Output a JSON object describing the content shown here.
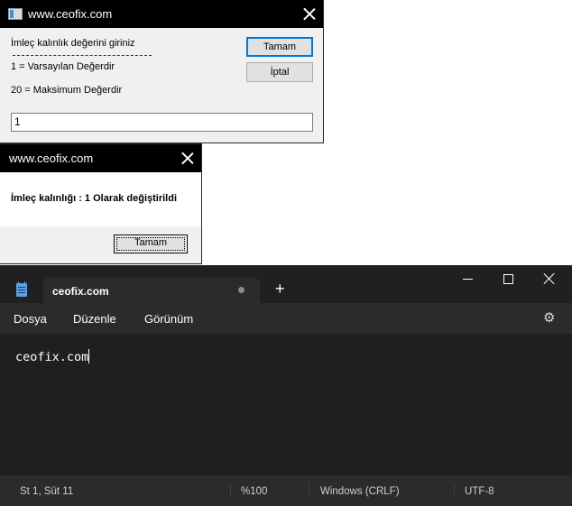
{
  "input_dialog": {
    "title": "www.ceofix.com",
    "prompt_line1": "İmleç kalınlık değerini giriniz",
    "prompt_line2": "1 = Varsayılan Değerdir",
    "prompt_line3": "20 = Maksimum Değerdir",
    "ok_label": "Tamam",
    "cancel_label": "İptal",
    "input_value": "1"
  },
  "message_dialog": {
    "title": "www.ceofix.com",
    "message": "İmleç kalınlığı : 1 Olarak değiştirildi",
    "ok_label": "Tamam"
  },
  "notepad": {
    "tab_title": "ceofix.com",
    "new_tab": "+",
    "menu": [
      "Dosya",
      "Düzenle",
      "Görünüm"
    ],
    "content": "ceofix.com",
    "status": {
      "position": "St 1, Süt 11",
      "zoom": "%100",
      "line_ending": "Windows (CRLF)",
      "encoding": "UTF-8"
    },
    "icons": {
      "app": "notepad-icon",
      "modified": "unsaved-dot-icon",
      "settings": "gear-icon"
    }
  }
}
